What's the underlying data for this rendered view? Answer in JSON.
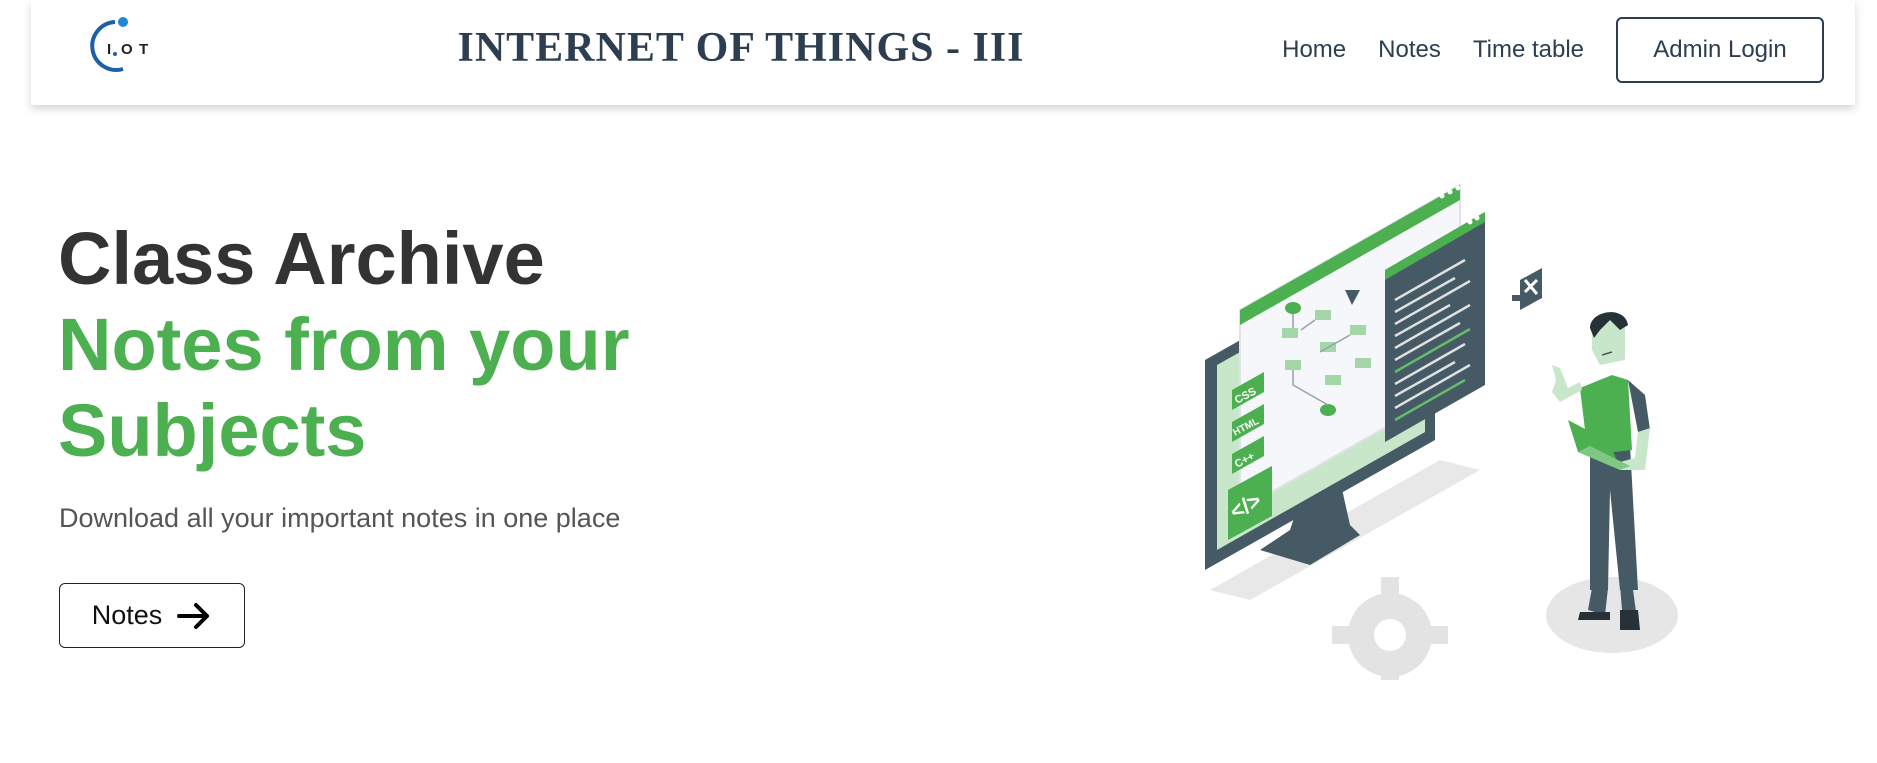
{
  "header": {
    "logo_letters": [
      "I",
      "O",
      "T"
    ],
    "title": "INTERNET OF THINGS - III",
    "nav": [
      {
        "label": "Home"
      },
      {
        "label": "Notes"
      },
      {
        "label": "Time table"
      }
    ],
    "admin_label": "Admin Login"
  },
  "hero": {
    "title_line1": "Class Archive",
    "title_line2": "Notes from your Subjects",
    "subtitle": "Download all your important notes in one place",
    "button_label": "Notes",
    "button_icon": "arrow-right-icon"
  },
  "illustration": {
    "tags": [
      "CSS",
      "HTML",
      "C++"
    ],
    "code_glyph": "</>",
    "accent_color": "#4caf50",
    "dark_color": "#455a64"
  },
  "colors": {
    "title_dark": "#333333",
    "accent_green": "#4caf50",
    "nav_text": "#2c3e50",
    "subtitle_gray": "#555555"
  }
}
